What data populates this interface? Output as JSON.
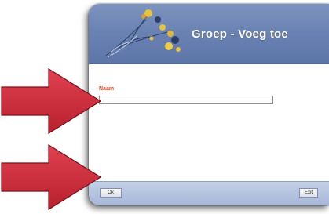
{
  "dialog": {
    "title": "Groep - Voeg toe",
    "field_label": "Naam",
    "field_value": "",
    "ok_label": "Ok",
    "exit_label": "Exit"
  },
  "colors": {
    "header": "#6b83b3",
    "footer": "#b0c0dd",
    "label": "#e0471e",
    "arrow": "#d12d3e"
  },
  "annotations": {
    "arrow_count": 2
  }
}
